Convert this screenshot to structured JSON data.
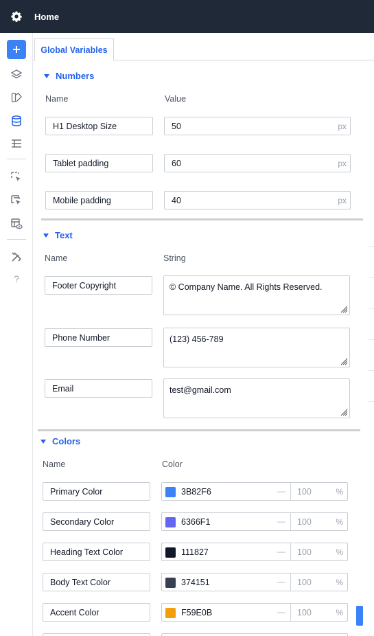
{
  "header": {
    "title": "Home",
    "gear_icon": "gear-icon"
  },
  "sidebar": {
    "items": [
      {
        "name": "add",
        "icon": "plus-icon"
      },
      {
        "name": "layers",
        "icon": "layers-icon"
      },
      {
        "name": "assets",
        "icon": "shapes-icon"
      },
      {
        "name": "database",
        "icon": "database-icon"
      },
      {
        "name": "list",
        "icon": "list-icon"
      },
      {
        "name": "select",
        "icon": "selection-icon"
      },
      {
        "name": "select-multiple",
        "icon": "selection-multiple-icon"
      },
      {
        "name": "preview",
        "icon": "layout-eye-icon"
      },
      {
        "name": "tools",
        "icon": "tools-icon"
      },
      {
        "name": "help",
        "icon": "question-icon"
      }
    ]
  },
  "tabs": {
    "active": "Global Variables"
  },
  "numbers": {
    "title": "Numbers",
    "col_name": "Name",
    "col_value": "Value",
    "rows": [
      {
        "name": "H1 Desktop Size",
        "value": "50",
        "unit": "px"
      },
      {
        "name": "Tablet padding",
        "value": "60",
        "unit": "px"
      },
      {
        "name": "Mobile padding",
        "value": "40",
        "unit": "px"
      }
    ]
  },
  "text": {
    "title": "Text",
    "col_name": "Name",
    "col_value": "String",
    "rows": [
      {
        "name": "Footer Copyright",
        "value": "© Company Name. All Rights Reserved."
      },
      {
        "name": "Phone Number",
        "value": "(123) 456-789"
      },
      {
        "name": "Email",
        "value": "test@gmail.com"
      }
    ]
  },
  "colors": {
    "title": "Colors",
    "col_name": "Name",
    "col_value": "Color",
    "rows": [
      {
        "name": "Primary Color",
        "hex": "3B82F6",
        "swatch": "#3B82F6",
        "dash": "—",
        "opacity": "100",
        "pct": "%"
      },
      {
        "name": "Secondary Color",
        "hex": "6366F1",
        "swatch": "#6366F1",
        "dash": "—",
        "opacity": "100",
        "pct": "%"
      },
      {
        "name": "Heading Text Color",
        "hex": "111827",
        "swatch": "#111827",
        "dash": "—",
        "opacity": "100",
        "pct": "%"
      },
      {
        "name": "Body Text Color",
        "hex": "374151",
        "swatch": "#374151",
        "dash": "—",
        "opacity": "100",
        "pct": "%"
      },
      {
        "name": "Accent Color",
        "hex": "F59E0B",
        "swatch": "#F59E0B",
        "dash": "—",
        "opacity": "100",
        "pct": "%"
      }
    ]
  },
  "accent": "#3b82f6"
}
